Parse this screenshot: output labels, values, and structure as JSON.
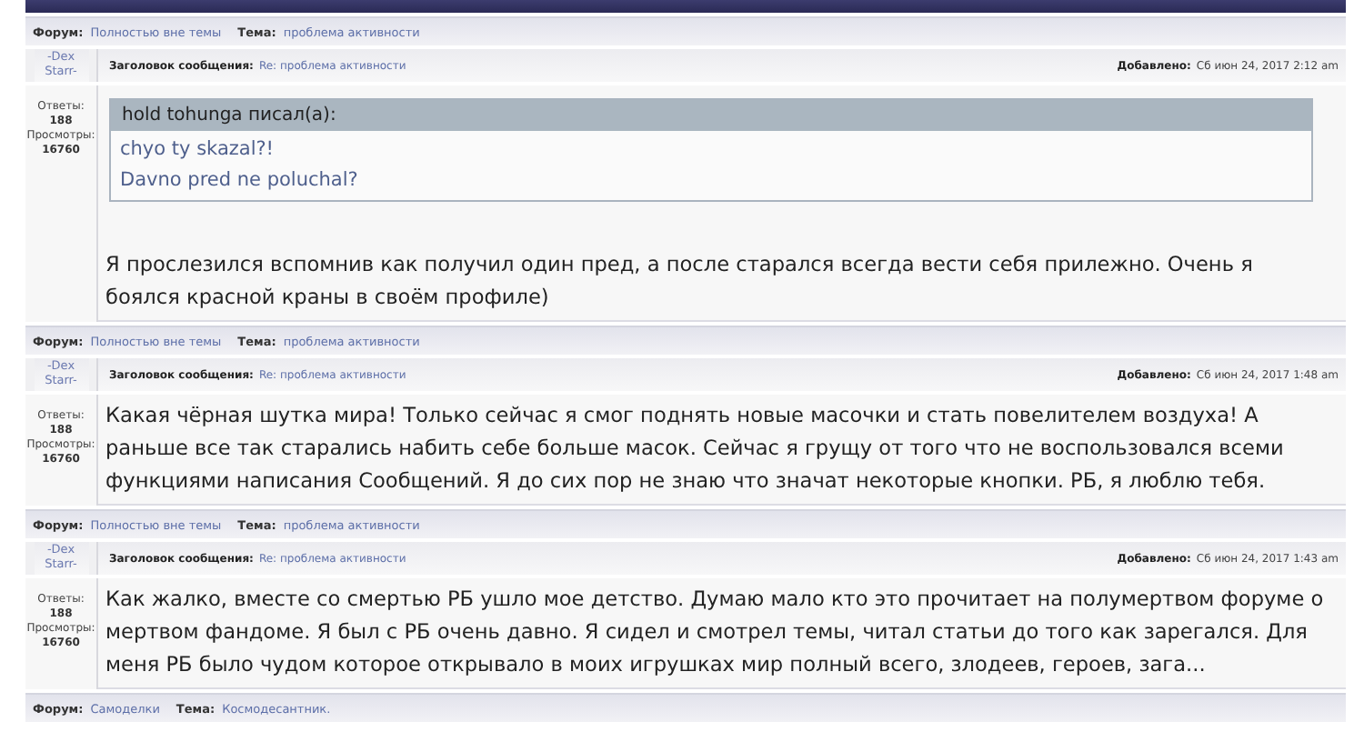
{
  "posts": [
    {
      "forum_label": "Форум:",
      "forum": "Полностью вне темы",
      "topic_label": "Тема:",
      "topic": "проблема активности",
      "author": "-Dex Starr-",
      "subject_label": "Заголовок сообщения:",
      "subject": "Re: проблема активности",
      "posted_label": "Добавлено:",
      "posted": "Сб июн 24, 2017 2:12 am",
      "replies_label": "Ответы:",
      "replies": "188",
      "views_label": "Просмотры:",
      "views": "16760",
      "quote": {
        "author": "hold tohunga писал(а):",
        "lines": [
          "chyo ty skazal?!",
          "Davno pred ne poluchal?"
        ]
      },
      "text": "Я прослезился вспомнив как получил один пред, а после старался всегда вести себя прилежно. Очень я боялся красной краны в своём профиле)"
    },
    {
      "forum_label": "Форум:",
      "forum": "Полностью вне темы",
      "topic_label": "Тема:",
      "topic": "проблема активности",
      "author": "-Dex Starr-",
      "subject_label": "Заголовок сообщения:",
      "subject": "Re: проблема активности",
      "posted_label": "Добавлено:",
      "posted": "Сб июн 24, 2017 1:48 am",
      "replies_label": "Ответы:",
      "replies": "188",
      "views_label": "Просмотры:",
      "views": "16760",
      "text": "Какая чёрная шутка мира! Только сейчас я смог поднять новые масочки и стать повелителем воздуха! А раньше все так старались набить себе больше масок. Сейчас я грущу от того что не воспользовался всеми функциями написания Сообщений. Я до сих пор не знаю что значат некоторые кнопки. РБ, я люблю тебя."
    },
    {
      "forum_label": "Форум:",
      "forum": "Полностью вне темы",
      "topic_label": "Тема:",
      "topic": "проблема активности",
      "author": "-Dex Starr-",
      "subject_label": "Заголовок сообщения:",
      "subject": "Re: проблема активности",
      "posted_label": "Добавлено:",
      "posted": "Сб июн 24, 2017 1:43 am",
      "replies_label": "Ответы:",
      "replies": "188",
      "views_label": "Просмотры:",
      "views": "16760",
      "text": "Как жалко, вместе со смертью РБ ушло мое детство. Думаю мало кто это прочитает на полумертвом форуме о мертвом фандоме. Я был с РБ очень давно. Я сидел и смотрел темы, читал статьи до того как зарегался. Для меня РБ было чудом которое открывало в моих игрушках мир полный всего, злодеев, героев, зага..."
    }
  ],
  "next_topic": {
    "forum_label": "Форум:",
    "forum": "Самоделки",
    "topic_label": "Тема:",
    "topic": "Космодесантник."
  }
}
